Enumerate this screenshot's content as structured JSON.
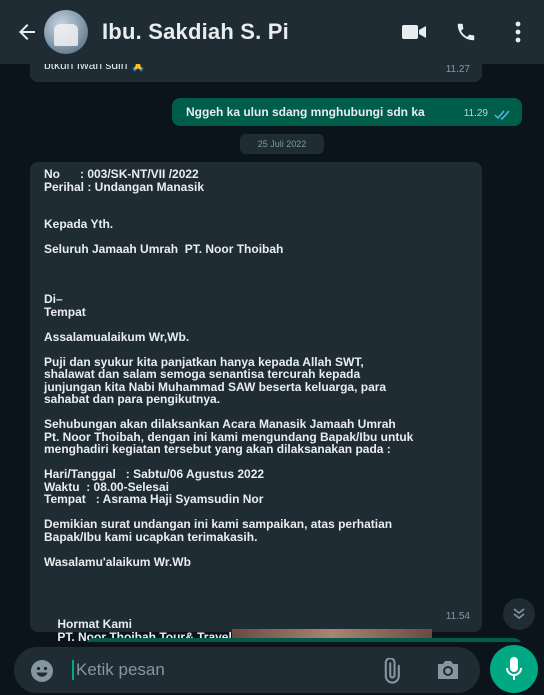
{
  "header": {
    "contact_name": "Ibu. Sakdiah S. Pi",
    "icons": [
      "back-arrow-icon",
      "video-call-icon",
      "voice-call-icon",
      "more-vertical-icon"
    ]
  },
  "messages": [
    {
      "direction": "in",
      "text": "btkun Iwan sdin 🙏",
      "time": "11.27"
    },
    {
      "direction": "out",
      "text": "Nggeh ka ulun sdang mnghubungi sdn ka",
      "time": "11.29",
      "status": "read"
    }
  ],
  "date_chip": "25 Juli 2022",
  "letter": {
    "lines": [
      "No      : 003/SK-NT/VII /2022",
      "Perihal : Undangan Manasik",
      "",
      "",
      "Kepada Yth.",
      "",
      "Seluruh Jamaah Umrah  PT. Noor Thoibah",
      "",
      "",
      "",
      "Di–",
      "Tempat",
      "",
      "Assalamualaikum Wr,Wb.",
      "",
      "Puji dan syukur kita panjatkan hanya kepada Allah SWT,",
      "shalawat dan salam semoga senantisa tercurah kepada",
      "junjungan kita Nabi Muhammad SAW beserta keluarga, para",
      "sahabat dan para pengikutnya.",
      "",
      "Sehubungan akan dilaksankan Acara Manasik Jamaah Umrah",
      "Pt. Noor Thoibah, dengan ini kami mengundang Bapak/Ibu untuk",
      "menghadiri kegiatan tersebut yang akan dilaksanakan pada :",
      "",
      "Hari/Tanggal   : Sabtu/06 Agustus 2022",
      "Waktu  : 08.00-Selesai",
      "Tempat   : Asrama Haji Syamsudin Nor",
      "",
      "Demikian surat undangan ini kami sampaikan, atas perhatian",
      "Bapak/Ibu kami ucapkan terimakasih.",
      "",
      "Wasalamu'alaikum Wr.Wb",
      "",
      "",
      "",
      "",
      "    Hormat Kami",
      "    PT. Noor Thoibah Tour& Travel"
    ],
    "time": "11.54"
  },
  "input": {
    "placeholder": "Ketik pesan"
  },
  "colors": {
    "background": "#0b141a",
    "header": "#1f2c34",
    "incoming_bubble": "#1f2c34",
    "outgoing_bubble": "#005c4b",
    "accent": "#00a884"
  }
}
